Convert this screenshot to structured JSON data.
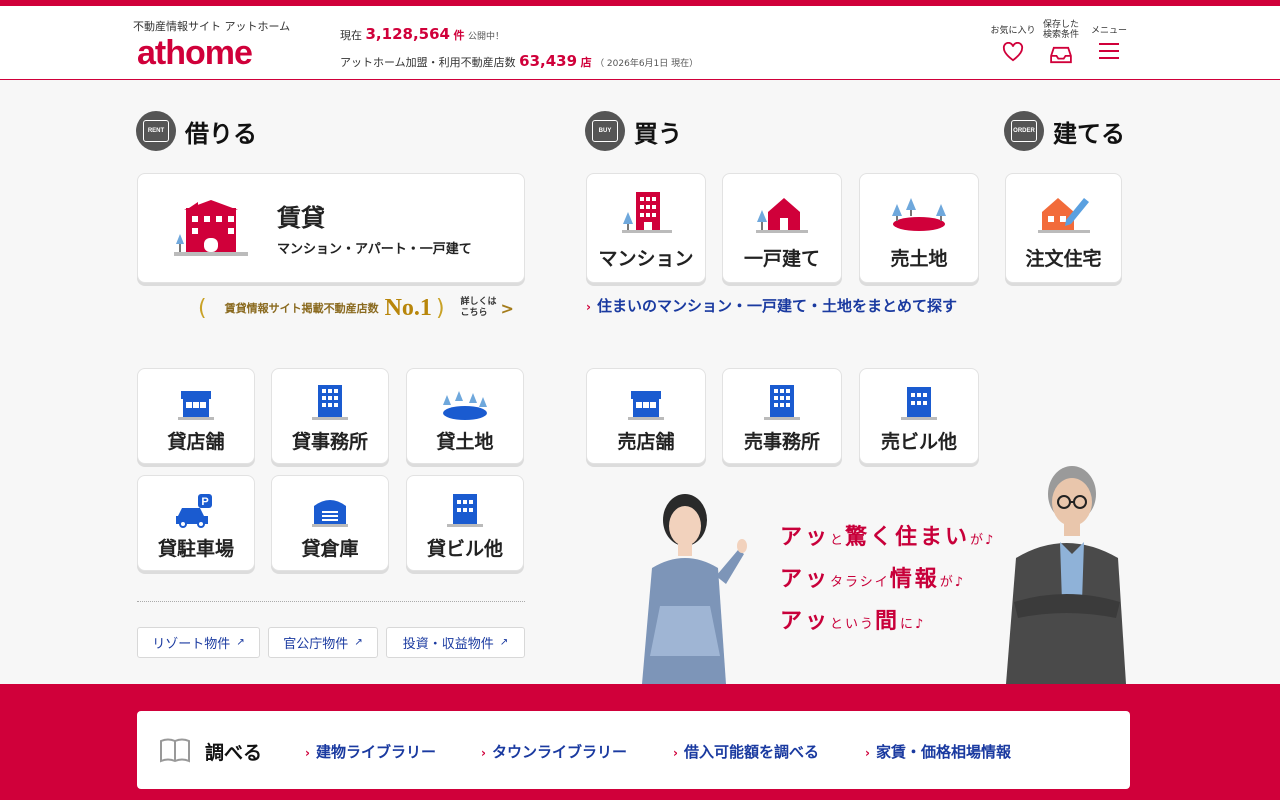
{
  "header": {
    "tagline": "不動産情報サイト アットホーム",
    "logo": "athome",
    "stats_line1_prefix": "現在",
    "stats_count": "3,128,564",
    "stats_count_unit": "件",
    "stats_line1_suffix": "公開中！",
    "stats_line2_prefix": "アットホーム加盟・利用不動産店数",
    "stats_shops": "63,439",
    "stats_shops_unit": "店",
    "stats_date": "（ 2026年6月1日 現在）",
    "fav_label": "お気に入り",
    "saved_label_1": "保存した",
    "saved_label_2": "検索条件",
    "menu_label": "メニュー"
  },
  "sections": {
    "rent": {
      "badge": "RENT",
      "title": "借りる"
    },
    "buy": {
      "badge": "BUY",
      "title": "買う"
    },
    "build": {
      "badge": "ORDER",
      "title": "建てる"
    }
  },
  "rent_main": {
    "title": "賃貸",
    "subtitle": "マンション・アパート・一戸建て"
  },
  "no1": {
    "text": "賃貸情報サイト掲載不動産店数",
    "rank": "No.1",
    "detail_1": "詳しくは",
    "detail_2": "こちら"
  },
  "buy_cards": [
    "マンション",
    "一戸建て",
    "売土地"
  ],
  "build_card": "注文住宅",
  "buy_link": "住まいのマンション・一戸建て・土地をまとめて探す",
  "rent_cards": [
    "貸店舗",
    "貸事務所",
    "貸土地",
    "貸駐車場",
    "貸倉庫",
    "貸ビル他"
  ],
  "buy_biz_cards": [
    "売店舗",
    "売事務所",
    "売ビル他"
  ],
  "ext_links": [
    "リゾート物件",
    "官公庁物件",
    "投資・収益物件"
  ],
  "promo": {
    "line1_a": "アッ",
    "line1_b": "と",
    "line1_c": "驚く住まい",
    "line1_d": "が♪",
    "line2_a": "アッ",
    "line2_b": "タラシイ",
    "line2_c": "情報",
    "line2_d": "が♪",
    "line3_a": "アッ",
    "line3_b": "という",
    "line3_c": "間",
    "line3_d": "に♪"
  },
  "research": {
    "title": "調べる",
    "links": [
      "建物ライブラリー",
      "タウンライブラリー",
      "借入可能額を調べる",
      "家賃・価格相場情報"
    ]
  },
  "colors": {
    "brand": "#d0003a",
    "link": "#1a3aa0",
    "icon_blue": "#1a5bd0"
  }
}
